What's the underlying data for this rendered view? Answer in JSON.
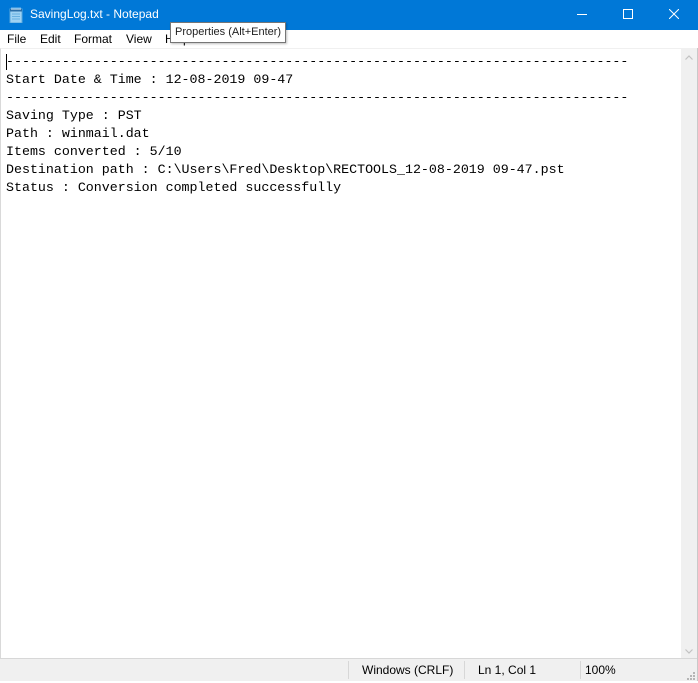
{
  "window": {
    "title": "SavingLog.txt - Notepad",
    "controls": {
      "minimize": "minimize",
      "maximize": "maximize",
      "close": "close"
    },
    "accent_color": "#0078d7"
  },
  "menu": {
    "items": [
      {
        "label": "File"
      },
      {
        "label": "Edit"
      },
      {
        "label": "Format"
      },
      {
        "label": "View"
      },
      {
        "label": "Help"
      }
    ]
  },
  "tooltip": {
    "text": "Properties (Alt+Enter)"
  },
  "document": {
    "lines": [
      "------------------------------------------------------------------------------",
      "Start Date & Time : 12-08-2019 09-47",
      "------------------------------------------------------------------------------",
      "Saving Type : PST",
      "Path : winmail.dat",
      "Items converted : 5/10",
      "Destination path : C:\\Users\\Fred\\Desktop\\RECTOOLS_12-08-2019 09-47.pst",
      "Status : Conversion completed successfully"
    ]
  },
  "statusbar": {
    "line_ending": "Windows (CRLF)",
    "position": "Ln 1, Col 1",
    "zoom": "100%"
  }
}
